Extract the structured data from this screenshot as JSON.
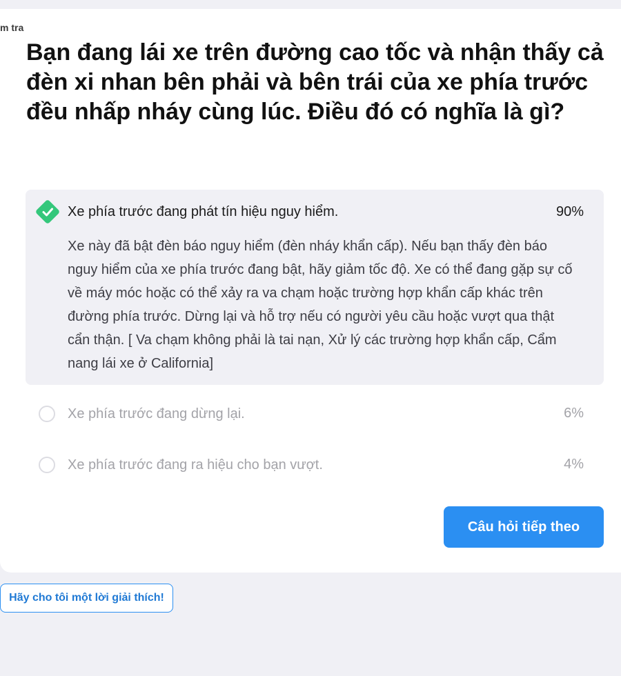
{
  "breadcrumb": "m tra",
  "question": "Bạn đang lái xe trên đường cao tốc và nhận thấy cả đèn xi nhan bên phải và bên trái của xe phía trước đều nhấp nháy cùng lúc. Điều đó có nghĩa là gì?",
  "options": [
    {
      "label": "Xe phía trước đang phát tín hiệu nguy hiểm.",
      "percent": "90%",
      "state": "correct",
      "explanation": "Xe này đã bật đèn báo nguy hiểm (đèn nháy khẩn cấp). Nếu bạn thấy đèn báo nguy hiểm của xe phía trước đang bật, hãy giảm tốc độ. Xe có thể đang gặp sự cố về máy móc hoặc có thể xảy ra va chạm hoặc trường hợp khẩn cấp khác trên đường phía trước. Dừng lại và hỗ trợ nếu có người yêu cầu hoặc vượt qua thật cẩn thận. [ Va chạm không phải là tai nạn, Xử lý các trường hợp khẩn cấp, Cẩm nang lái xe ở California]"
    },
    {
      "label": "Xe phía trước đang dừng lại.",
      "percent": "6%",
      "state": "unselected"
    },
    {
      "label": "Xe phía trước đang ra hiệu cho bạn vượt.",
      "percent": "4%",
      "state": "unselected"
    }
  ],
  "buttons": {
    "next": "Câu hỏi tiếp theo",
    "explain": "Hãy cho tôi một lời giải thích!"
  },
  "colors": {
    "accent": "#2b8ff2",
    "correct": "#34c77b",
    "page_bg": "#f0f0f5"
  },
  "icons": {
    "correct": "check-icon",
    "option": "radio-icon"
  }
}
